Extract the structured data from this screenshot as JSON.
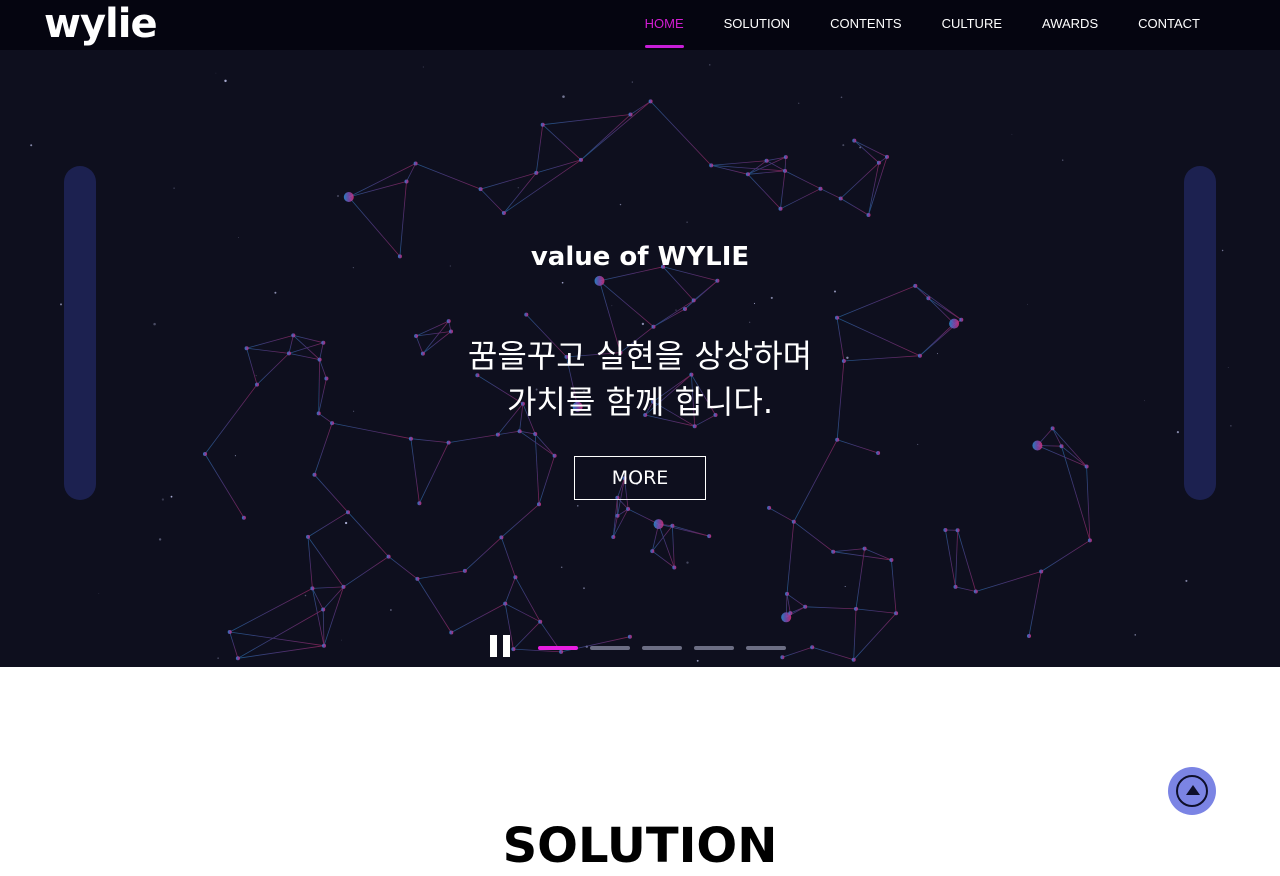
{
  "header": {
    "logo": "wylie",
    "nav": [
      "HOME",
      "SOLUTION",
      "CONTENTS",
      "CULTURE",
      "AWARDS",
      "CONTACT"
    ],
    "active_nav": "HOME"
  },
  "hero": {
    "subtitle": "value of WYLIE",
    "title_line1": "꿈을꾸고 실현을 상상하며",
    "title_line2": "가치를 함께 합니다.",
    "more_label": "MORE",
    "slide_count": 5,
    "active_slide": 1
  },
  "section": {
    "title": "SOLUTION"
  },
  "colors": {
    "header_bg": "#050510",
    "hero_bg": "#0e0f1e",
    "accent": "#d21dd2",
    "top_button": "#7b84e4"
  },
  "icons": {
    "pause": "pause-icon",
    "back_to_top": "arrow-up-icon"
  }
}
